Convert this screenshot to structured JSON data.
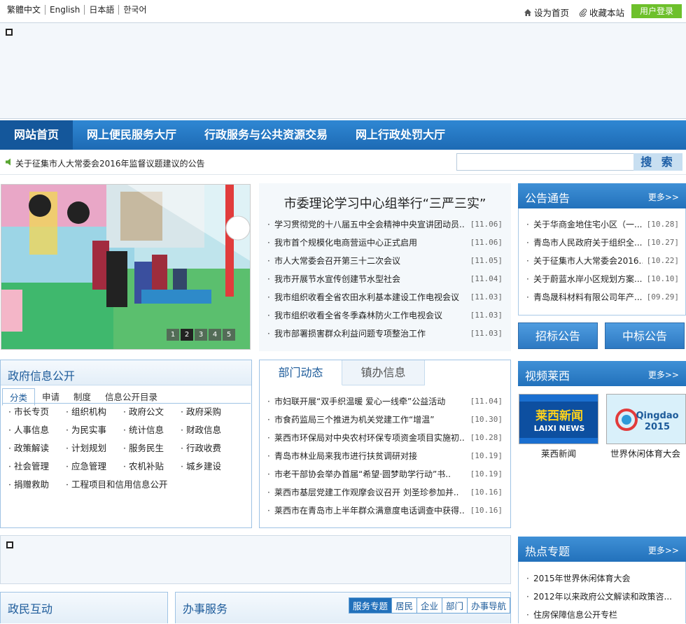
{
  "header": {
    "languages": [
      "繁體中文",
      "English",
      "日本語",
      "한국어"
    ],
    "set_home": "设为首页",
    "bookmark": "收藏本站",
    "login": "用户登录"
  },
  "nav": {
    "items": [
      "网站首页",
      "网上便民服务大厅",
      "行政服务与公共资源交易",
      "网上行政处罚大厅"
    ]
  },
  "ticker": {
    "text": "关于征集市人大常委会2016年监督议题建议的公告"
  },
  "search": {
    "button": "搜 索",
    "value": ""
  },
  "slideshow": {
    "pages": [
      "1",
      "2",
      "3",
      "4",
      "5"
    ],
    "active_page": "2"
  },
  "headline": {
    "title": "市委理论学习中心组举行“三严三实”",
    "items": [
      {
        "bullet": "·",
        "text": "学习贯彻党的十八届五中全会精神中央宣讲团动员..",
        "date": "[11.06]"
      },
      {
        "bullet": "·",
        "text": "我市首个规模化电商营运中心正式启用",
        "date": "[11.06]"
      },
      {
        "bullet": "·",
        "text": "市人大常委会召开第三十二次会议",
        "date": "[11.05]"
      },
      {
        "bullet": "·",
        "text": "我市开展节水宣传创建节水型社会",
        "date": "[11.04]"
      },
      {
        "bullet": "·",
        "text": "我市组织收看全省农田水利基本建设工作电视会议",
        "date": "[11.03]"
      },
      {
        "bullet": "·",
        "text": "我市组织收看全省冬季森林防火工作电视会议",
        "date": "[11.03]"
      },
      {
        "bullet": "·",
        "text": "我市部署损害群众利益问题专项整治工作",
        "date": "[11.03]"
      }
    ]
  },
  "notices": {
    "title": "公告通告",
    "more": "更多>>",
    "items": [
      {
        "bullet": "·",
        "text": "关于华商金地住宅小区（一...",
        "date": "[10.28]"
      },
      {
        "bullet": "·",
        "text": "青岛市人民政府关于组织全...",
        "date": "[10.27]"
      },
      {
        "bullet": "·",
        "text": "关于征集市人大常委会2016...",
        "date": "[10.22]"
      },
      {
        "bullet": "·",
        "text": "关于蔚蓝水岸小区规划方案...",
        "date": "[10.10]"
      },
      {
        "bullet": "·",
        "text": "青岛晟科材料有限公司年产...",
        "date": "[09.29]"
      }
    ]
  },
  "bid_buttons": {
    "tender": "招标公告",
    "award": "中标公告"
  },
  "gov_info": {
    "title": "政府信息公开",
    "tabs": [
      "分类",
      "申请",
      "制度",
      "信息公开目录"
    ],
    "active_tab": "分类",
    "categories": [
      "市长专页",
      "组织机构",
      "政府公文",
      "政府采购",
      "人事信息",
      "为民实事",
      "统计信息",
      "财政信息",
      "政策解读",
      "计划规划",
      "服务民生",
      "行政收费",
      "社会管理",
      "应急管理",
      "农机补贴",
      "城乡建设",
      "捐赠救助",
      "工程项目和信用信息公开"
    ]
  },
  "dept": {
    "tabs": [
      "部门动态",
      "镇办信息"
    ],
    "active_tab": "部门动态",
    "items": [
      {
        "bullet": "·",
        "text": "市妇联开展“双手织温暖 爱心一线牵”公益活动",
        "date": "[11.04]"
      },
      {
        "bullet": "·",
        "text": "市食药监局三个推进为机关党建工作“增温”",
        "date": "[10.30]"
      },
      {
        "bullet": "·",
        "text": "莱西市环保局对中央农村环保专项资金项目实施初..",
        "date": "[10.28]"
      },
      {
        "bullet": "·",
        "text": "青岛市林业局来我市进行扶贫调研对接",
        "date": "[10.19]"
      },
      {
        "bullet": "·",
        "text": "市老干部协会举办首届“希望·圆梦助学行动”书..",
        "date": "[10.19]"
      },
      {
        "bullet": "·",
        "text": "莱西市基层党建工作观摩会议召开 刘圣珍参加并..",
        "date": "[10.16]"
      },
      {
        "bullet": "·",
        "text": "莱西市在青岛市上半年群众满意度电话调查中获得..",
        "date": "[10.16]"
      }
    ]
  },
  "video": {
    "title": "视频莱西",
    "more": "更多>>",
    "items": [
      {
        "caption": "莱西新闻",
        "logo_cn": "莱西新闻",
        "logo_en": "LAIXI NEWS"
      },
      {
        "caption": "世界休闲体育大会",
        "logo_cn": "Qingdao",
        "logo_en": "2015"
      }
    ]
  },
  "hot": {
    "title": "热点专题",
    "more": "更多>>",
    "items": [
      {
        "bullet": "·",
        "text": "2015年世界休闲体育大会"
      },
      {
        "bullet": "·",
        "text": "2012年以来政府公文解读和政策咨..."
      },
      {
        "bullet": "·",
        "text": "住房保障信息公开专栏"
      }
    ]
  },
  "interaction": {
    "title": "政民互动"
  },
  "services": {
    "title": "办事服务",
    "tabs": [
      "服务专题",
      "居民",
      "企业",
      "部门",
      "办事导航"
    ],
    "active_tab": "服务专题"
  },
  "colors": {
    "nav_blue": "#1d6ab4",
    "login_green": "#6dc02b",
    "accent_blue": "#2271bb"
  }
}
